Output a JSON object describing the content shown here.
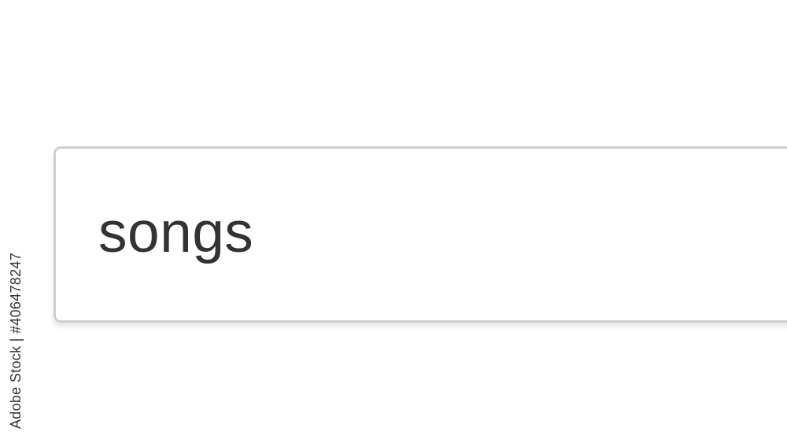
{
  "search": {
    "value": "songs"
  },
  "watermark": {
    "credit": "Adobe Stock | #406478247"
  },
  "colors": {
    "background": "#ffffff",
    "input_border": "#cfcfcf",
    "text": "#333333"
  }
}
